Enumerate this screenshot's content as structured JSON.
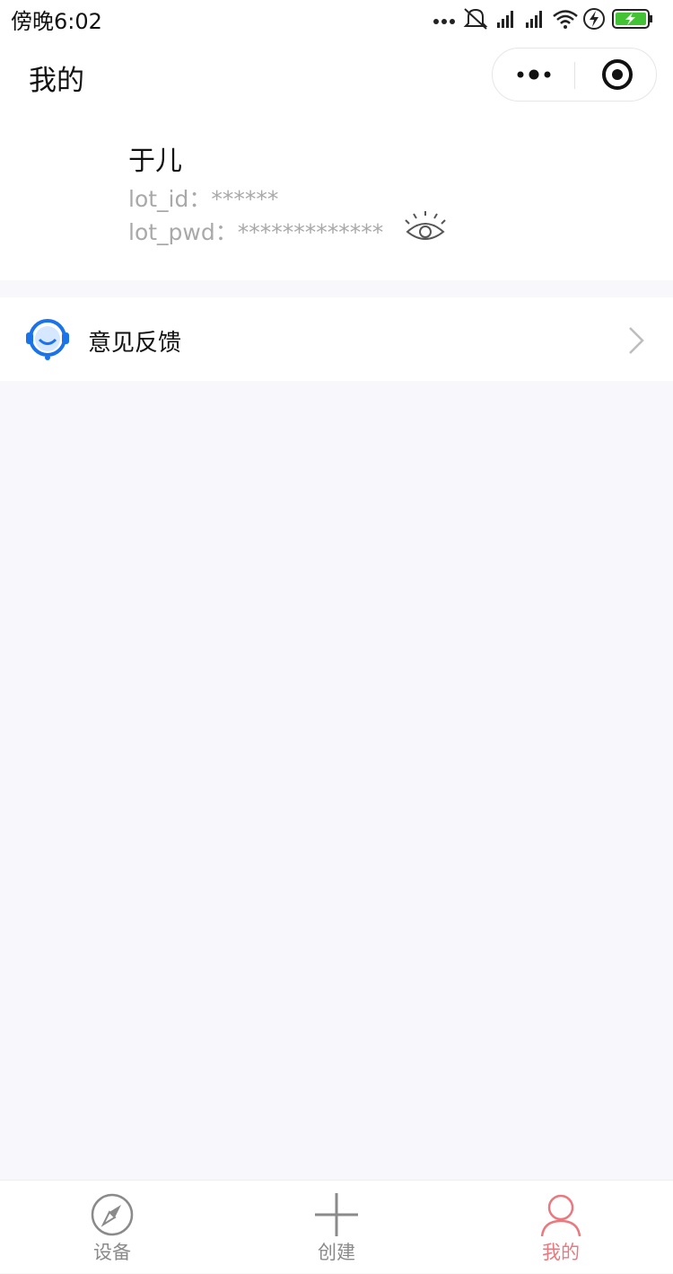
{
  "status_bar": {
    "time": "傍晚6:02",
    "icons": [
      "more-dots-icon",
      "mute-bell-icon",
      "signal-icon",
      "signal-icon",
      "wifi-icon",
      "charging-icon",
      "battery-icon"
    ],
    "battery_color": "#44c235"
  },
  "nav": {
    "title": "我的",
    "more_icon": "more-dots-icon",
    "close_icon": "target-circle-icon"
  },
  "profile": {
    "name": "于儿",
    "id_label": "lot_id：",
    "id_value": "******",
    "pwd_label": "lot_pwd：",
    "pwd_value": "*************",
    "reveal_icon": "eye-icon"
  },
  "menu": {
    "items": [
      {
        "label": "意见反馈",
        "icon": "customer-service-icon",
        "icon_color": "#1a73e8"
      }
    ]
  },
  "tabbar": {
    "active_color": "#e9787f",
    "inactive_color": "#8a8a8a",
    "tabs": [
      {
        "label": "设备",
        "icon": "compass-icon",
        "active": false
      },
      {
        "label": "创建",
        "icon": "plus-icon",
        "active": false
      },
      {
        "label": "我的",
        "icon": "user-icon",
        "active": true
      }
    ]
  }
}
